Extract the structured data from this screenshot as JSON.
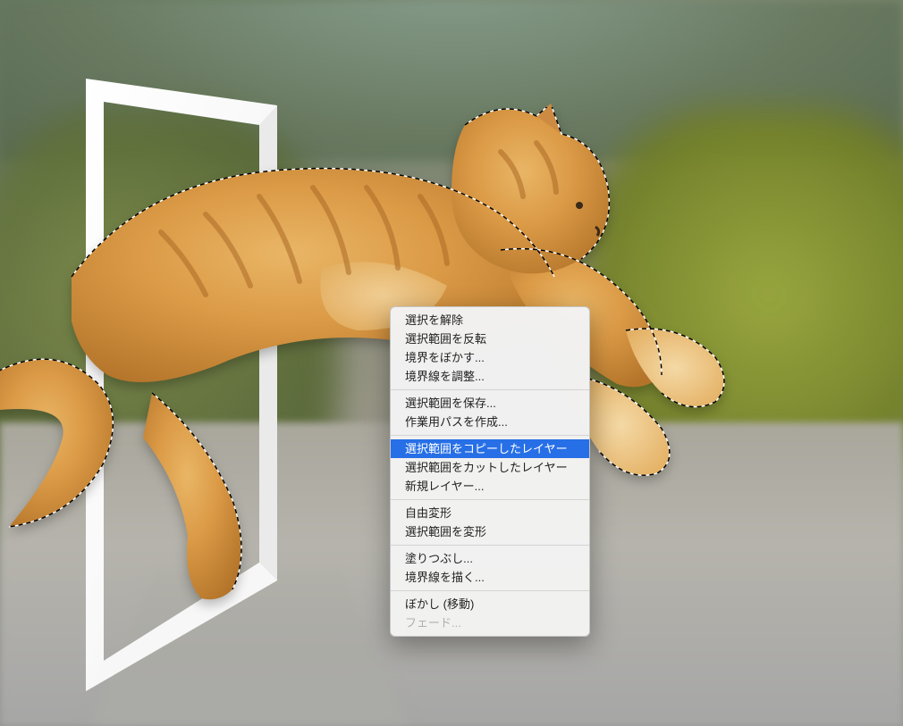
{
  "context_menu": {
    "groups": [
      [
        {
          "label": "選択を解除",
          "disabled": false,
          "highlighted": false
        },
        {
          "label": "選択範囲を反転",
          "disabled": false,
          "highlighted": false
        },
        {
          "label": "境界をぼかす...",
          "disabled": false,
          "highlighted": false
        },
        {
          "label": "境界線を調整...",
          "disabled": false,
          "highlighted": false
        }
      ],
      [
        {
          "label": "選択範囲を保存...",
          "disabled": false,
          "highlighted": false
        },
        {
          "label": "作業用パスを作成...",
          "disabled": false,
          "highlighted": false
        }
      ],
      [
        {
          "label": "選択範囲をコピーしたレイヤー",
          "disabled": false,
          "highlighted": true
        },
        {
          "label": "選択範囲をカットしたレイヤー",
          "disabled": false,
          "highlighted": false
        },
        {
          "label": "新規レイヤー...",
          "disabled": false,
          "highlighted": false
        }
      ],
      [
        {
          "label": "自由変形",
          "disabled": false,
          "highlighted": false
        },
        {
          "label": "選択範囲を変形",
          "disabled": false,
          "highlighted": false
        }
      ],
      [
        {
          "label": "塗りつぶし...",
          "disabled": false,
          "highlighted": false
        },
        {
          "label": "境界線を描く...",
          "disabled": false,
          "highlighted": false
        }
      ],
      [
        {
          "label": "ぼかし (移動)",
          "disabled": false,
          "highlighted": false
        },
        {
          "label": "フェード...",
          "disabled": true,
          "highlighted": false
        }
      ]
    ]
  }
}
